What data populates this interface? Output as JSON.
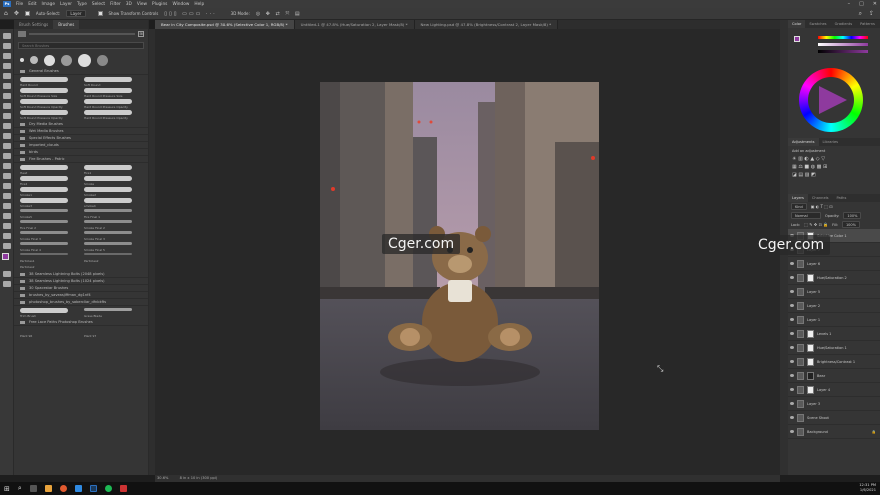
{
  "app": {
    "menu": [
      "File",
      "Edit",
      "Image",
      "Layer",
      "Type",
      "Select",
      "Filter",
      "3D",
      "View",
      "Plugins",
      "Window",
      "Help"
    ],
    "logo": "Ps"
  },
  "options": {
    "auto_select_label": "Auto-Select:",
    "auto_select_value": "Layer",
    "transform_label": "Show Transform Controls",
    "mode_3d": "3D Mode:"
  },
  "tabs": [
    {
      "label": "Bear in City Composite.psd @ 30.6% (Selective Color 1, RGB/8) *"
    },
    {
      "label": "Untitled-1 @ 47.8% (Hue/Saturation 2, Layer Mask/8) *"
    },
    {
      "label": "New Lighting.psd @ 47.8% (Brightness/Contrast 2, Layer Mask/8) *"
    }
  ],
  "brushes_panel": {
    "tab_settings": "Brush Settings",
    "tab_brushes": "Brushes",
    "search_placeholder": "Search Brushes",
    "general_folder": "General Brushes",
    "general_items": [
      {
        "label": "Hard Round"
      },
      {
        "label": "Soft Round"
      },
      {
        "label": "Soft Round Pressure Size"
      },
      {
        "label": "Hard Round Pressure Size"
      },
      {
        "label": "Soft Round Pressure Opacity"
      },
      {
        "label": "Hard Round Pressure Opacity"
      },
      {
        "label": "Soft Round Pressure Opacity"
      },
      {
        "label": "Hard Round Pressure Opacity"
      }
    ],
    "folders_a": [
      "Dry Media Brushes",
      "Wet Media Brushes",
      "Special Effects Brushes",
      "imported_clouds",
      "birds"
    ],
    "fx_folder": "Fire Brushes - Patric",
    "fx_items": [
      {
        "label": "Heat"
      },
      {
        "label": "Fire1"
      },
      {
        "label": "Fire2"
      },
      {
        "label": "Smoke"
      },
      {
        "label": "Smoke1"
      },
      {
        "label": "Smoke2"
      },
      {
        "label": "Smoke3"
      },
      {
        "label": "smoke4"
      },
      {
        "label": "Smoke5"
      },
      {
        "label": "Fire Final 1"
      },
      {
        "label": "Fire Final 2"
      },
      {
        "label": "Smoke Final 2"
      },
      {
        "label": "Smoke Final 3"
      },
      {
        "label": "Smoke Final 3"
      },
      {
        "label": "Smoke Final 4"
      },
      {
        "label": "Smoke Final 5"
      },
      {
        "label": "Particles1"
      },
      {
        "label": "Particles2"
      }
    ],
    "particle_label": "Particles2",
    "folders_b": [
      "38 Seamless Lightning Bolts (2048 pixels)",
      "38 Seamless Lightning Bolts (1024 pixels)",
      "30 Spacestar Brushes",
      "brushes_by_saveasjiffman_dg1nf4",
      "photoshop_brushes_by_sabercliar_dfnbkfts"
    ],
    "last_items": [
      {
        "label": "Trim Brush"
      },
      {
        "label": "Grass Blade"
      }
    ],
    "last_folder": "Free Lace Paths Photoshop Brushes",
    "final_items": [
      {
        "label": "Plant 96"
      },
      {
        "label": "Plant 97"
      }
    ]
  },
  "photo": {
    "watermark": "Cger.com"
  },
  "watermark_right": "Cger.com",
  "right_panel": {
    "color_tabs": [
      "Color",
      "Swatches",
      "Gradients",
      "Patterns"
    ],
    "adjust_tabs": [
      "Adjustments",
      "Libraries"
    ],
    "adjust_hint": "Add an adjustment",
    "layer_tabs": [
      "Layers",
      "Channels",
      "Paths"
    ],
    "kind_label": "Kind",
    "blend_mode": "Normal",
    "opacity_label": "Opacity:",
    "opacity_value": "100%",
    "lock_label": "Lock:",
    "fill_label": "Fill:",
    "fill_value": "100%",
    "layers": [
      {
        "label": "Selective Color 1"
      },
      {
        "label": "Layer 7"
      },
      {
        "label": "Layer 6"
      },
      {
        "label": "Hue/Saturation 2"
      },
      {
        "label": "Layer 5"
      },
      {
        "label": "Layer 2"
      },
      {
        "label": "Layer 1"
      },
      {
        "label": "Levels 1"
      },
      {
        "label": "Hue/Saturation 1"
      },
      {
        "label": "Brightness/Contrast 1"
      },
      {
        "label": "Bear"
      },
      {
        "label": "Layer 4"
      },
      {
        "label": "Layer 3"
      },
      {
        "label": "Scene Shoot"
      },
      {
        "label": "Background"
      }
    ]
  },
  "status": {
    "zoom": "30.6%",
    "size": "8 in x 10 in (300 ppi)"
  },
  "taskbar": {
    "time": "12:31 PM",
    "date": "1/6/2021"
  },
  "colors": {
    "accent": "#2b6fbf",
    "fg_swatch": "#8e3a9e"
  }
}
